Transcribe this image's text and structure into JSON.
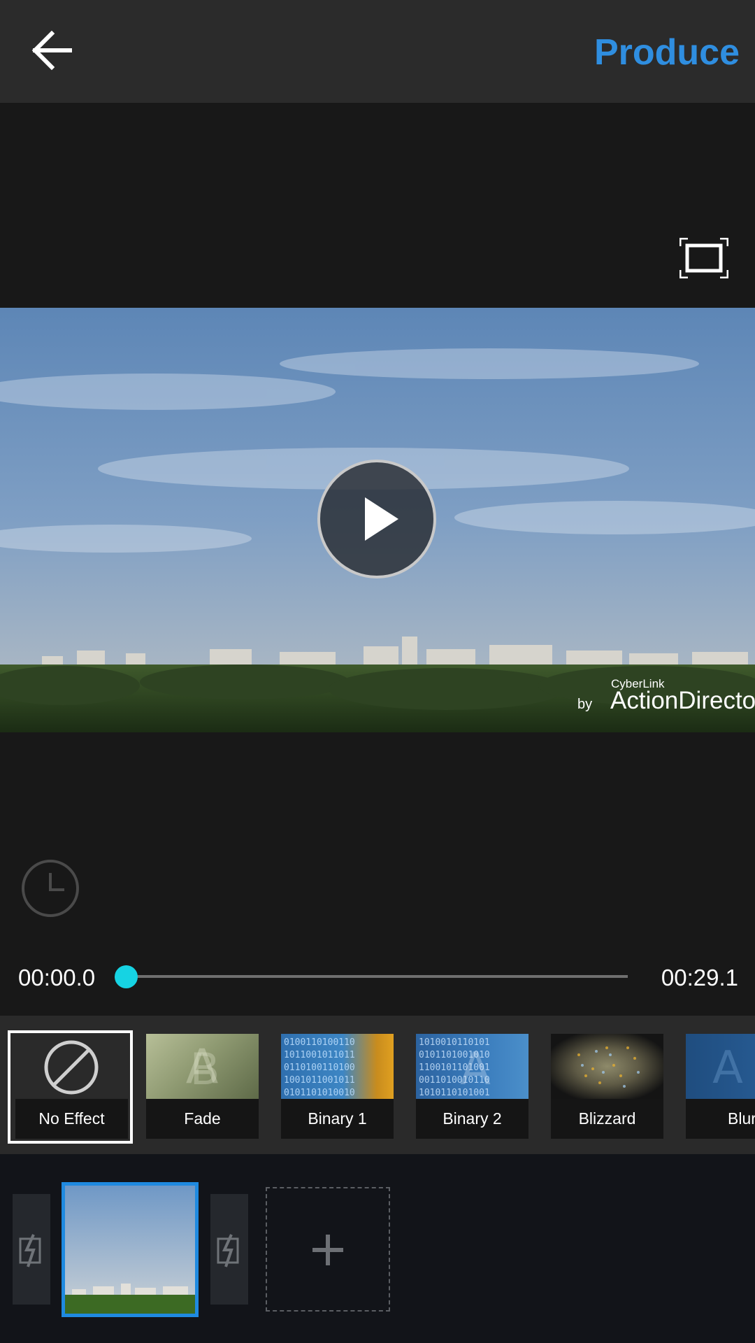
{
  "topbar": {
    "back_icon": "arrow-left-icon",
    "produce_label": "Produce",
    "accent_color": "#2f8ee0"
  },
  "preview": {
    "fullscreen_icon": "fullscreen-icon",
    "play_icon": "play-icon",
    "watermark": {
      "brand": "CyberLink",
      "by": "by",
      "name": "ActionDirector"
    }
  },
  "controls": {
    "duration_icon": "clock-icon",
    "time_start": "00:00.0",
    "time_end": "00:29.1",
    "progress": 0.0,
    "knob_color": "#16d3e3"
  },
  "effects": [
    {
      "label": "No Effect",
      "icon": "no-effect-icon",
      "selected": true
    },
    {
      "label": "Fade",
      "selected": false
    },
    {
      "label": "Binary 1",
      "selected": false
    },
    {
      "label": "Binary 2",
      "selected": false
    },
    {
      "label": "Blizzard",
      "selected": false
    },
    {
      "label": "Blur",
      "selected": false
    }
  ],
  "timeline": {
    "transition_icon": "transition-icon",
    "add_icon": "plus-icon",
    "clip_border_color": "#1f8ae0"
  }
}
